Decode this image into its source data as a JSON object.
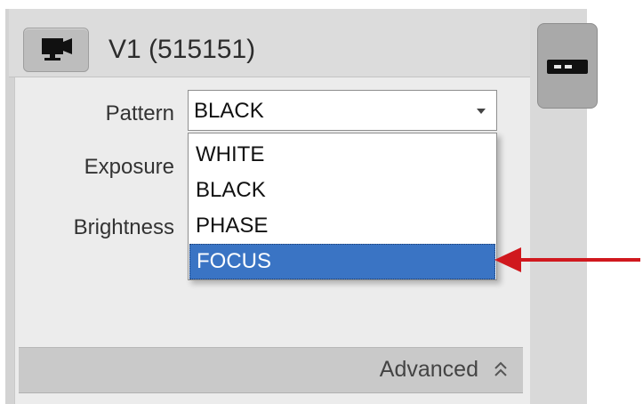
{
  "header": {
    "camera_icon": "video-camera-icon",
    "title": "V1 (515151)"
  },
  "fields": {
    "pattern_label": "Pattern",
    "exposure_label": "Exposure",
    "brightness_label": "Brightness"
  },
  "pattern_select": {
    "value": "BLACK",
    "options": [
      "WHITE",
      "BLACK",
      "PHASE",
      "FOCUS"
    ],
    "highlighted": "FOCUS"
  },
  "advanced": {
    "label": "Advanced",
    "icon": "double-chevron-up-icon"
  },
  "side_panel": {
    "icon": "camera-body-icon"
  },
  "annotation": {
    "arrow_color": "#d0181e"
  }
}
